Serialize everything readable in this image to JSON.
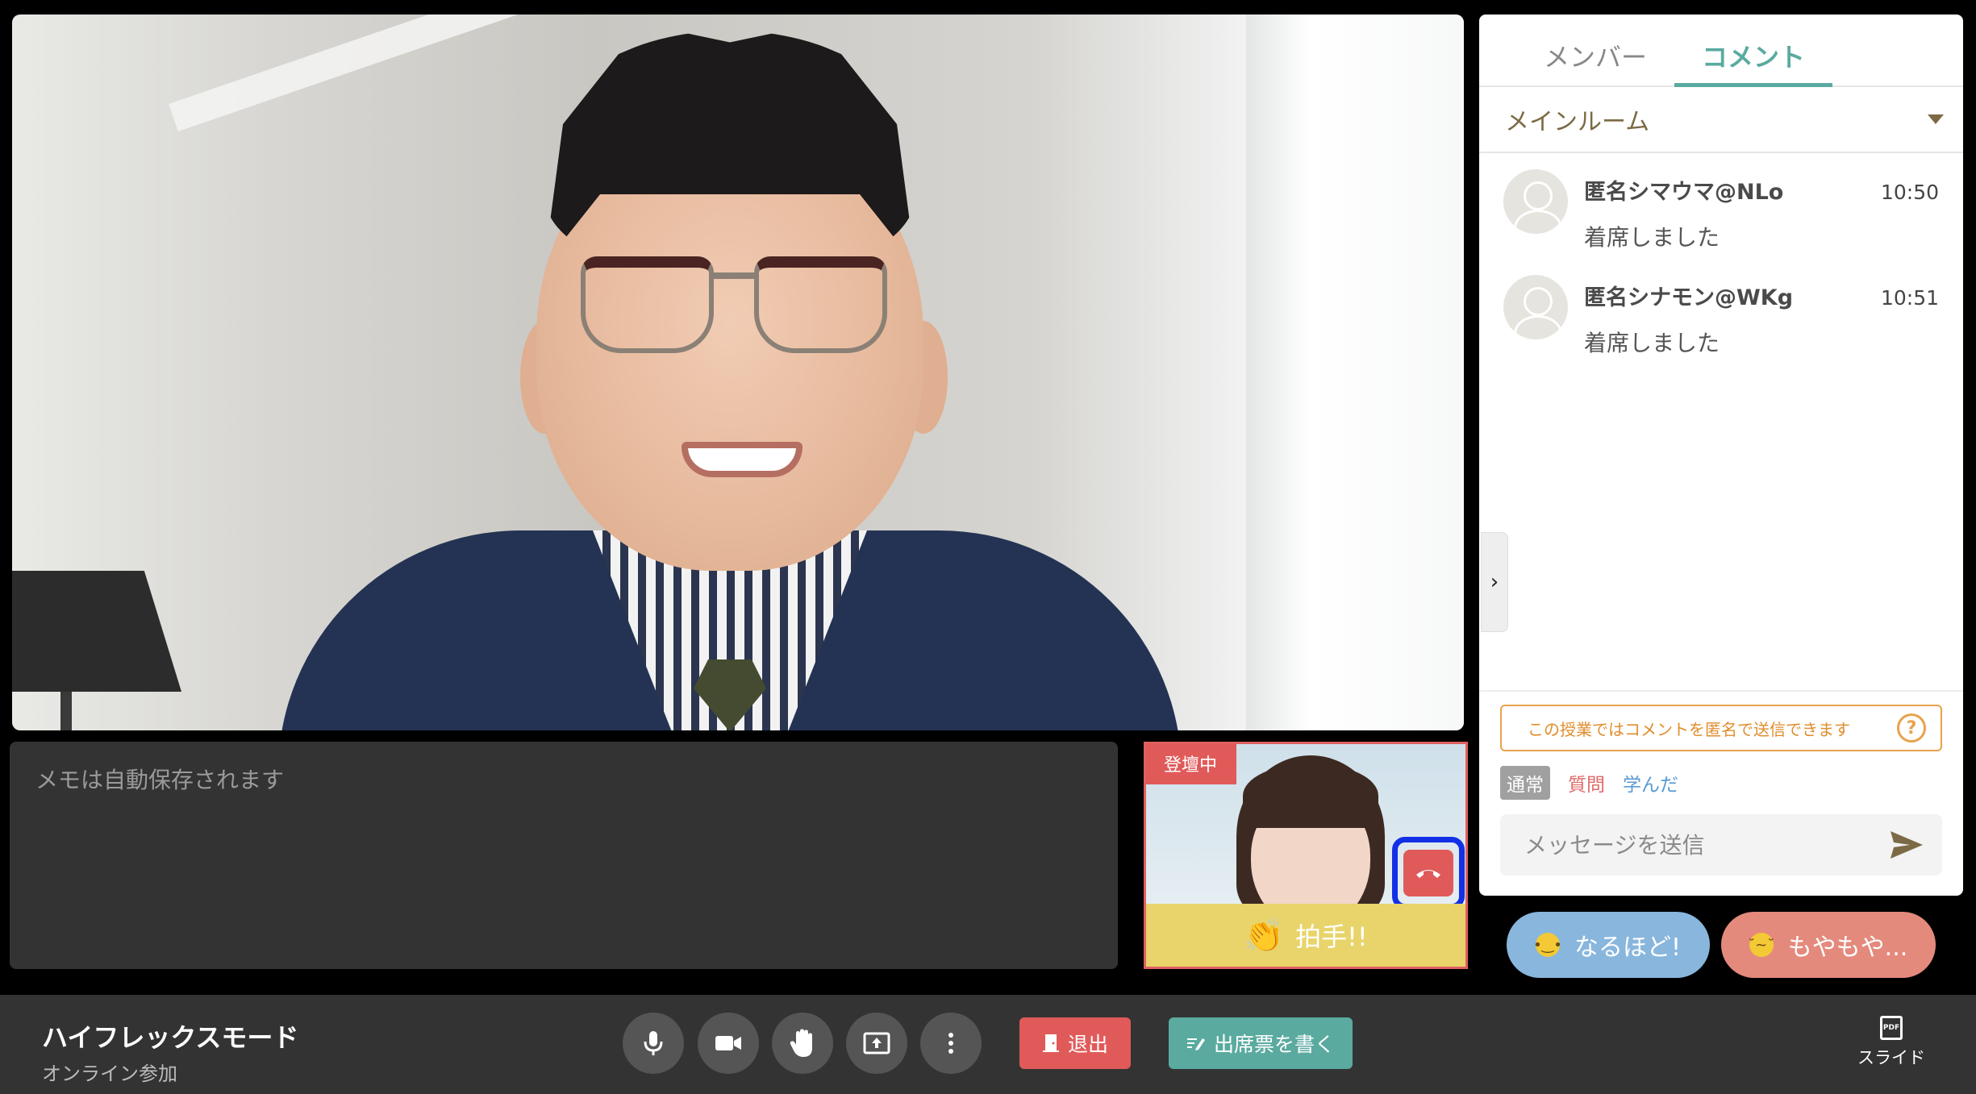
{
  "memo": {
    "placeholder": "メモは自動保存されます"
  },
  "self_video": {
    "badge": "登壇中",
    "clap_label": "拍手!!"
  },
  "side_panel": {
    "tabs": [
      {
        "label": "メンバー",
        "active": false
      },
      {
        "label": "コメント",
        "active": true
      }
    ],
    "room": "メインルーム",
    "comments": [
      {
        "name": "匿名シマウマ@NLo",
        "time": "10:50",
        "text": "着席しました"
      },
      {
        "name": "匿名シナモン@WKg",
        "time": "10:51",
        "text": "着席しました"
      }
    ],
    "notice": "この授業ではコメントを匿名で送信できます",
    "notice_help": "?",
    "types": [
      "通常",
      "質問",
      "学んだ"
    ],
    "message_placeholder": "メッセージを送信"
  },
  "reactions": {
    "naruhodo": "なるほど!",
    "moyamoya": "もやもや..."
  },
  "bottom_bar": {
    "mode_title": "ハイフレックスモード",
    "mode_sub": "オンライン参加",
    "leave_label": "退出",
    "attend_label": "出席票を書く",
    "slide_label": "スライド",
    "pdf_text": "PDF"
  },
  "icons": {
    "mic": "microphone-icon",
    "camera": "video-camera-icon",
    "hand": "raise-hand-icon",
    "share": "screen-share-icon",
    "more": "more-vertical-icon"
  },
  "colors": {
    "accent": "#5aaa9f",
    "danger": "#e05a5a",
    "notice": "#e8a24a",
    "clap": "#e8d46a"
  }
}
